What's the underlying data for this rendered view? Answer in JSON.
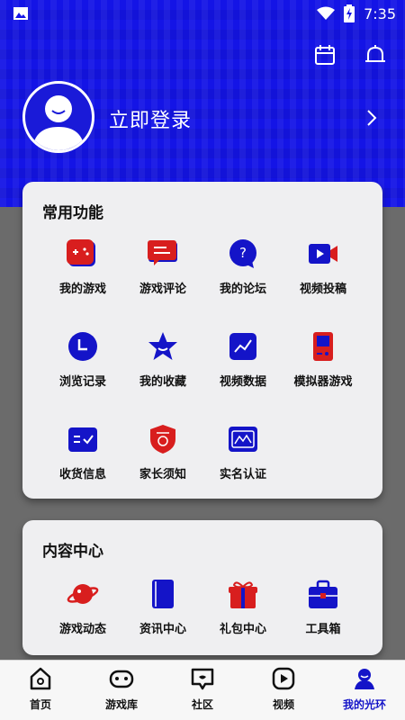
{
  "status_bar": {
    "time": "7:35"
  },
  "profile": {
    "login_label": "立即登录"
  },
  "common_functions": {
    "title": "常用功能",
    "items": [
      {
        "label": "我的游戏",
        "icon": "gamepad-icon"
      },
      {
        "label": "游戏评论",
        "icon": "comment-icon"
      },
      {
        "label": "我的论坛",
        "icon": "forum-question-icon"
      },
      {
        "label": "视频投稿",
        "icon": "video-camera-icon"
      },
      {
        "label": "浏览记录",
        "icon": "clock-icon"
      },
      {
        "label": "我的收藏",
        "icon": "star-icon"
      },
      {
        "label": "视频数据",
        "icon": "chart-icon"
      },
      {
        "label": "模拟器游戏",
        "icon": "handheld-console-icon"
      },
      {
        "label": "收货信息",
        "icon": "address-card-icon"
      },
      {
        "label": "家长须知",
        "icon": "shield-icon"
      },
      {
        "label": "实名认证",
        "icon": "id-card-icon"
      }
    ]
  },
  "content_center": {
    "title": "内容中心",
    "items": [
      {
        "label": "游戏动态",
        "icon": "planet-icon"
      },
      {
        "label": "资讯中心",
        "icon": "book-icon"
      },
      {
        "label": "礼包中心",
        "icon": "gift-icon"
      },
      {
        "label": "工具箱",
        "icon": "toolbox-icon"
      }
    ]
  },
  "tabbar": {
    "items": [
      {
        "label": "首页",
        "icon": "home-icon"
      },
      {
        "label": "游戏库",
        "icon": "game-library-icon"
      },
      {
        "label": "社区",
        "icon": "community-icon"
      },
      {
        "label": "视频",
        "icon": "video-icon"
      },
      {
        "label": "我的光环",
        "icon": "profile-icon",
        "active": true
      }
    ]
  },
  "colors": {
    "primary": "#1414e6",
    "accent_red": "#d81e1e",
    "card_bg": "#efeff1"
  }
}
